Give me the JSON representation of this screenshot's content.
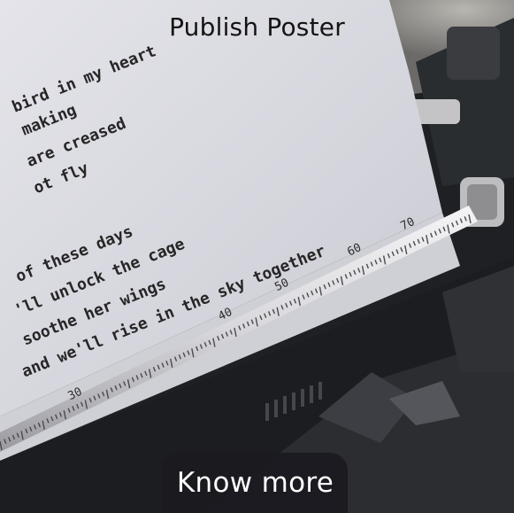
{
  "poster": {
    "title": "Publish Poster",
    "cta_label": "Know more"
  },
  "photo": {
    "poem_lines": [
      "bird in my heart",
      "making",
      "are creased",
      "ot fly",
      "of these days",
      "'ll unlock the cage",
      "soothe her wings",
      "and we'll rise in the sky together"
    ],
    "ruler_numbers": [
      "70",
      "60",
      "50",
      "40",
      "30"
    ]
  },
  "colors": {
    "paper": "#d9d9e0",
    "button_bg": "#1a1a1f",
    "button_text": "#ffffff",
    "title_text": "#141414"
  }
}
